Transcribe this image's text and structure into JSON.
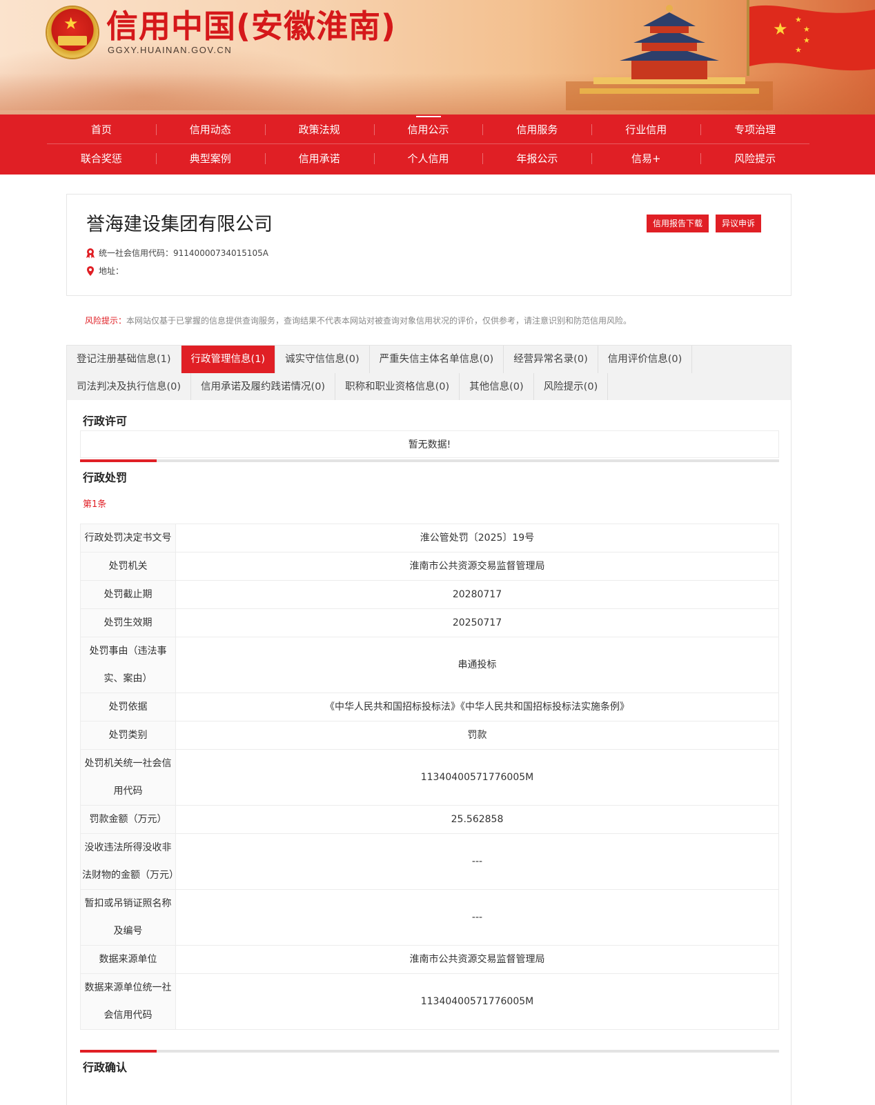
{
  "header": {
    "site_title": "信用中国(安徽淮南)",
    "site_domain": "GGXY.HUAINAN.GOV.CN"
  },
  "nav": {
    "row1": [
      "首页",
      "信用动态",
      "政策法规",
      "信用公示",
      "信用服务",
      "行业信用",
      "专项治理"
    ],
    "row2": [
      "联合奖惩",
      "典型案例",
      "信用承诺",
      "个人信用",
      "年报公示",
      "信易+",
      "风险提示"
    ],
    "active": "信用公示"
  },
  "company": {
    "name": "誉海建设集团有限公司",
    "credit_code_label": "统一社会信用代码：",
    "credit_code": "91140000734015105A",
    "address_label": "地址：",
    "address": "",
    "report_button": "信用报告下载",
    "appeal_button": "异议申诉"
  },
  "risk_notice": {
    "label": "风险提示：",
    "text": "本网站仅基于已掌握的信息提供查询服务，查询结果不代表本网站对被查询对象信用状况的评价，仅供参考，请注意识别和防范信用风险。"
  },
  "tabs": {
    "row1": [
      "登记注册基础信息(1)",
      "行政管理信息(1)",
      "诚实守信信息(0)",
      "严重失信主体名单信息(0)",
      "经营异常名录(0)",
      "信用评价信息(0)"
    ],
    "row2": [
      "司法判决及执行信息(0)",
      "信用承诺及履约践诺情况(0)",
      "职称和职业资格信息(0)",
      "其他信息(0)",
      "风险提示(0)"
    ],
    "active": "行政管理信息(1)"
  },
  "sections": {
    "license": {
      "title": "行政许可",
      "empty_text": "暂无数据!"
    },
    "penalty": {
      "title": "行政处罚",
      "record_label": "第1条",
      "rows": [
        {
          "key": "行政处罚决定书文号",
          "value": "淮公管处罚〔2025〕19号"
        },
        {
          "key": "处罚机关",
          "value": "淮南市公共资源交易监督管理局"
        },
        {
          "key": "处罚截止期",
          "value": "20280717"
        },
        {
          "key": "处罚生效期",
          "value": "20250717"
        },
        {
          "key": "处罚事由（违法事实、案由）",
          "value": "串通投标"
        },
        {
          "key": "处罚依据",
          "value": "《中华人民共和国招标投标法》《中华人民共和国招标投标法实施条例》"
        },
        {
          "key": "处罚类别",
          "value": "罚款"
        },
        {
          "key": "处罚机关统一社会信用代码",
          "value": "11340400571776005M"
        },
        {
          "key": "罚款金额（万元）",
          "value": "25.562858"
        },
        {
          "key": "没收违法所得没收非法财物的金额（万元）",
          "value": "---"
        },
        {
          "key": "暂扣或吊销证照名称及编号",
          "value": "---"
        },
        {
          "key": "数据来源单位",
          "value": "淮南市公共资源交易监督管理局"
        },
        {
          "key": "数据来源单位统一社会信用代码",
          "value": "11340400571776005M"
        }
      ]
    },
    "confirmation": {
      "title": "行政确认"
    }
  },
  "colors": {
    "brand_red": "#e01f25",
    "title_red": "#d5181a"
  }
}
